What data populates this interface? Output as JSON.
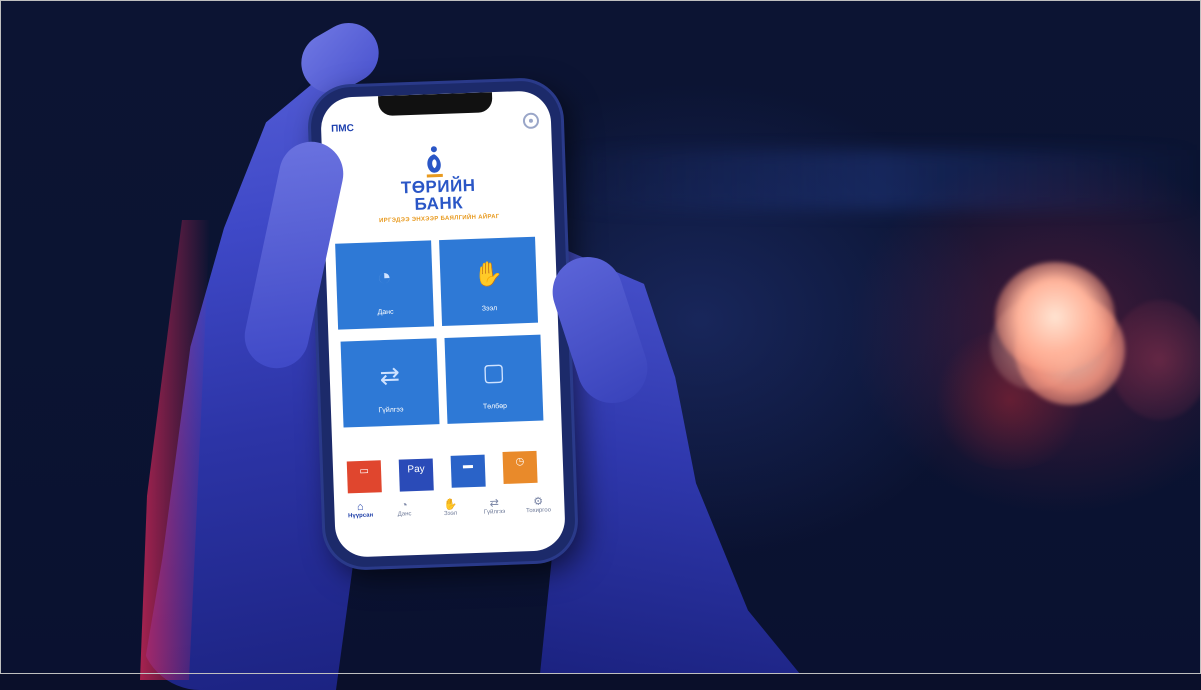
{
  "photo": {
    "description_colors": {
      "background": "#0b1432",
      "bokeh": "#ffb39a",
      "hand_tint": "#3f49c8"
    }
  },
  "app": {
    "header_brand": "ПМС",
    "settings_icon": "settings-icon",
    "logo": {
      "line1": "ТӨРИЙН",
      "line2": "БАНК",
      "tagline": "ИРГЭДЭЭ ЭНХЭЭР БАЯЛГИЙН АЙРАГ",
      "brand_color": "#2a56c6"
    },
    "tiles": [
      {
        "label": "Данс",
        "icon": "piggy-bank-icon"
      },
      {
        "label": "Зээл",
        "icon": "handshake-icon"
      },
      {
        "label": "Гүйлгээ",
        "icon": "transfer-icon"
      },
      {
        "label": "Төлбөр",
        "icon": "shopping-bag-icon"
      }
    ],
    "tile_color": "#2e79d6",
    "quick_actions": [
      {
        "label": "",
        "icon": "wallet-icon",
        "color": "#e0462e"
      },
      {
        "label": "Pay",
        "icon": "pay-icon",
        "color": "#2a4bb8"
      },
      {
        "label": "",
        "icon": "card-icon",
        "color": "#2a63c8"
      },
      {
        "label": "",
        "icon": "clock-icon",
        "color": "#e98a2a"
      }
    ],
    "nav": [
      {
        "label": "Нүүрсан",
        "icon": "home-icon",
        "active": true
      },
      {
        "label": "Данс",
        "icon": "account-icon"
      },
      {
        "label": "Зээл",
        "icon": "loan-icon"
      },
      {
        "label": "Гүйлгээ",
        "icon": "transactions-icon"
      },
      {
        "label": "Тохиргоо",
        "icon": "gear-icon"
      }
    ]
  }
}
